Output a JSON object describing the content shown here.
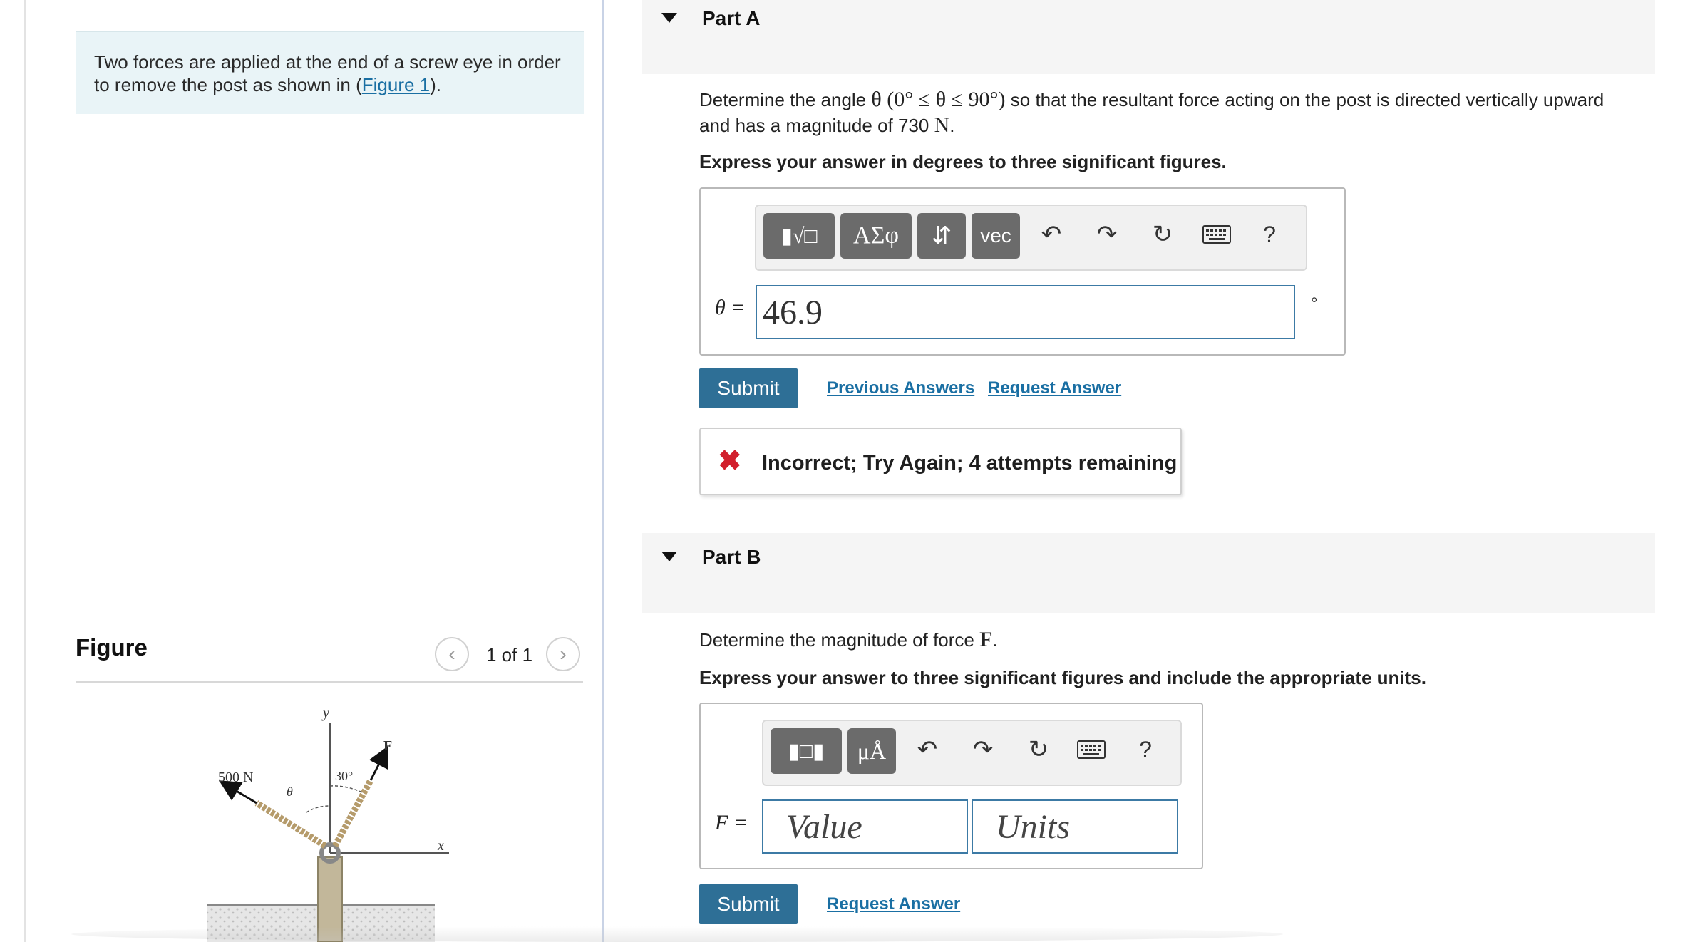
{
  "intro": {
    "text_before": "Two forces are applied at the end of a screw eye in order to remove the post as shown in (",
    "link": "Figure 1",
    "text_after": ")."
  },
  "figure": {
    "title": "Figure",
    "counter": "1 of 1",
    "prev_icon": "chevron-left-icon",
    "next_icon": "chevron-right-icon",
    "labels": {
      "y_axis": "y",
      "x_axis": "x",
      "force_left": "500 N",
      "force_right": "F",
      "theta": "θ",
      "angle": "30°"
    }
  },
  "part_a": {
    "title": "Part A",
    "question_pre": "Determine the angle ",
    "question_math": "θ (0° ≤ θ ≤ 90°)",
    "question_mid": " so that the resultant force acting on the post is directed vertically upward",
    "question_line2_pre": "and has a magnitude of 730 ",
    "question_unit": "N",
    "question_line2_post": ".",
    "instruction": "Express your answer in degrees to three significant figures.",
    "toolbar": {
      "templates_icon": "fraction-radical-template-icon",
      "greek_label": "ΑΣφ",
      "arrows_label": "⇵",
      "vec_label": "vec",
      "undo_icon": "undo-icon",
      "redo_icon": "redo-icon",
      "reset_icon": "reset-icon",
      "keyboard_icon": "keyboard-icon",
      "help_label": "?"
    },
    "answer_label": "θ =",
    "answer_value": "46.9",
    "unit_label": "°",
    "submit_label": "Submit",
    "previous_answers_label": "Previous Answers",
    "request_answer_label": "Request Answer",
    "feedback": "Incorrect; Try Again; 4 attempts remaining"
  },
  "part_b": {
    "title": "Part B",
    "question_pre": "Determine the magnitude of force ",
    "question_math": "F",
    "question_post": ".",
    "instruction": "Express your answer to three significant figures and include the appropriate units.",
    "toolbar": {
      "templates_icon": "templates-icon",
      "units_label": "μÅ",
      "undo_icon": "undo-icon",
      "redo_icon": "redo-icon",
      "reset_icon": "reset-icon",
      "keyboard_icon": "keyboard-icon",
      "help_label": "?"
    },
    "answer_label": "F =",
    "value_placeholder": "Value",
    "units_placeholder": "Units",
    "submit_label": "Submit",
    "request_answer_label": "Request Answer"
  }
}
